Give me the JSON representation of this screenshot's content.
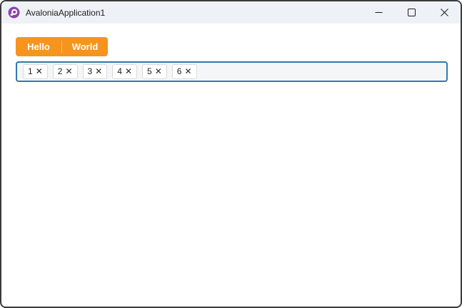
{
  "window": {
    "title": "AvaloniaApplication1"
  },
  "tabstrip": {
    "items": [
      {
        "label": "Hello"
      },
      {
        "label": "World"
      }
    ]
  },
  "chips": {
    "remove_glyph": "✕",
    "items": [
      {
        "label": "1"
      },
      {
        "label": "2"
      },
      {
        "label": "3"
      },
      {
        "label": "4"
      },
      {
        "label": "5"
      },
      {
        "label": "6"
      }
    ]
  },
  "colors": {
    "accent_orange": "#F7941E",
    "focus_border": "#2F79AD",
    "avalonia_purple": "#8B44A8",
    "titlebar_bg": "#EEF2F7",
    "window_border": "#3B3B3B"
  }
}
